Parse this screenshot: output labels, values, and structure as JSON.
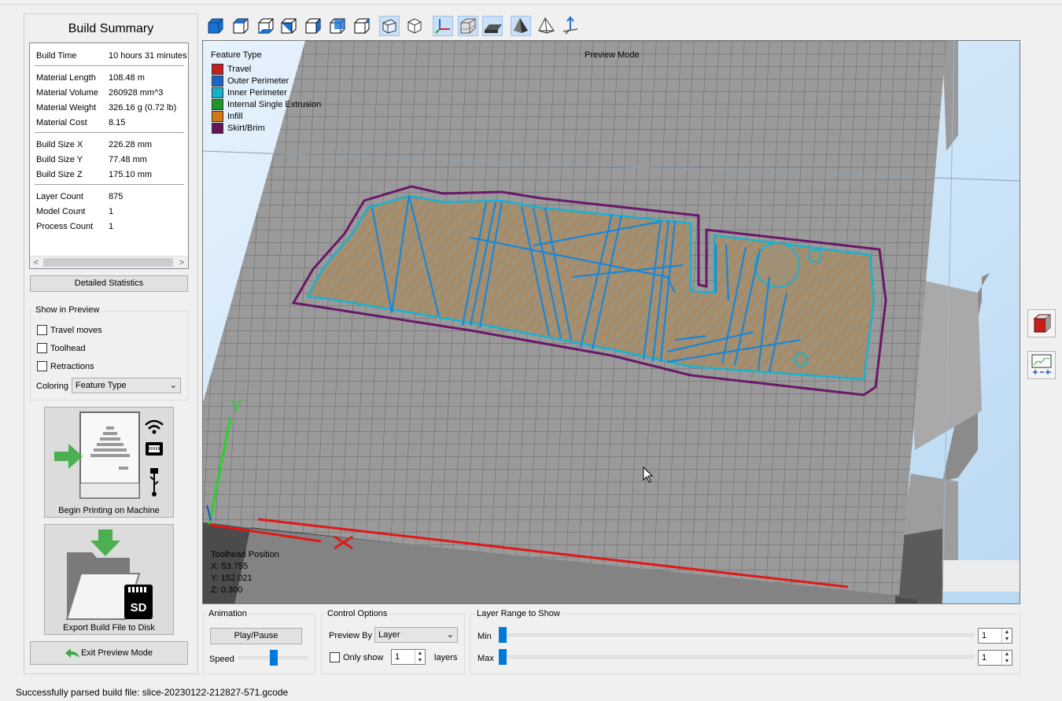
{
  "summary": {
    "title": "Build Summary",
    "rows": [
      {
        "k": "Build Time",
        "v": "10 hours 31 minutes"
      },
      {
        "k": "Material Length",
        "v": "108.48 m"
      },
      {
        "k": "Material Volume",
        "v": "260928 mm^3"
      },
      {
        "k": "Material Weight",
        "v": "326.16 g (0.72 lb)"
      },
      {
        "k": "Material Cost",
        "v": "8.15"
      },
      {
        "k": "Build Size X",
        "v": "226.28 mm"
      },
      {
        "k": "Build Size Y",
        "v": "77.48 mm"
      },
      {
        "k": "Build Size Z",
        "v": "175.10 mm"
      },
      {
        "k": "Layer Count",
        "v": "875"
      },
      {
        "k": "Model Count",
        "v": "1"
      },
      {
        "k": "Process Count",
        "v": "1"
      }
    ],
    "detailed_button": "Detailed Statistics"
  },
  "show_in_preview": {
    "title": "Show in Preview",
    "travel": "Travel moves",
    "toolhead": "Toolhead",
    "retractions": "Retractions",
    "coloring_label": "Coloring",
    "coloring_value": "Feature Type"
  },
  "actions": {
    "begin_printing": "Begin Printing on Machine",
    "export": "Export Build File to Disk",
    "sd_label": "SD",
    "exit_preview": "Exit Preview Mode"
  },
  "viewport": {
    "mode_label": "Preview Mode",
    "legend_title": "Feature Type",
    "legend": [
      {
        "name": "Travel",
        "color": "#c81e1e"
      },
      {
        "name": "Outer Perimeter",
        "color": "#1e64c8"
      },
      {
        "name": "Inner Perimeter",
        "color": "#14b4c8"
      },
      {
        "name": "Internal Single Extrusion",
        "color": "#1e9628"
      },
      {
        "name": "Infill",
        "color": "#d27814"
      },
      {
        "name": "Skirt/Brim",
        "color": "#64145a"
      }
    ],
    "toolhead_title": "Toolhead Position",
    "x": "X: 53.755",
    "y": "Y: 152.021",
    "z": "Z: 0.300",
    "axis_y": "Y"
  },
  "animation": {
    "title": "Animation",
    "play_pause": "Play/Pause",
    "speed_label": "Speed"
  },
  "control": {
    "title": "Control Options",
    "preview_by_label": "Preview By",
    "preview_by_value": "Layer",
    "only_show": "Only show",
    "only_show_value": "1",
    "layers": "layers"
  },
  "layer_range": {
    "title": "Layer Range to Show",
    "min_label": "Min",
    "max_label": "Max",
    "min_value": "1",
    "max_value": "1"
  },
  "status": "Successfully parsed build file: slice-20230122-212827-571.gcode"
}
